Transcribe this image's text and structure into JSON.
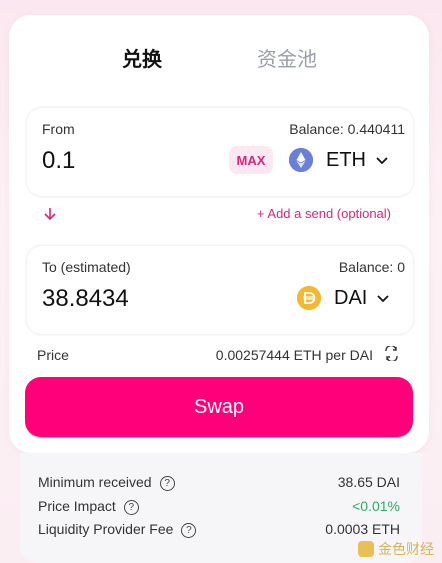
{
  "tabs": {
    "swap": "兑换",
    "pool": "资金池"
  },
  "from": {
    "label": "From",
    "balance": "Balance: 0.440411",
    "amount": "0.1",
    "max_label": "MAX",
    "token": "ETH",
    "token_icon": "eth-icon"
  },
  "to": {
    "label": "To (estimated)",
    "balance": "Balance: 0",
    "amount": "38.8434",
    "token": "DAI",
    "token_icon": "dai-icon"
  },
  "arrow": "↓",
  "add_send": "+ Add a send (optional)",
  "price": {
    "label": "Price",
    "value": "0.00257444 ETH per DAI"
  },
  "swap_button": "Swap",
  "details": {
    "minimum_received": {
      "label": "Minimum received",
      "value": "38.65 DAI"
    },
    "price_impact": {
      "label": "Price Impact",
      "value": "<0.01%"
    },
    "lp_fee": {
      "label": "Liquidity Provider Fee",
      "value": "0.0003 ETH"
    }
  },
  "watermark": "金色财经",
  "colors": {
    "accent": "#ff007a",
    "accent_text": "#d1287d",
    "positive": "#27ae60"
  }
}
